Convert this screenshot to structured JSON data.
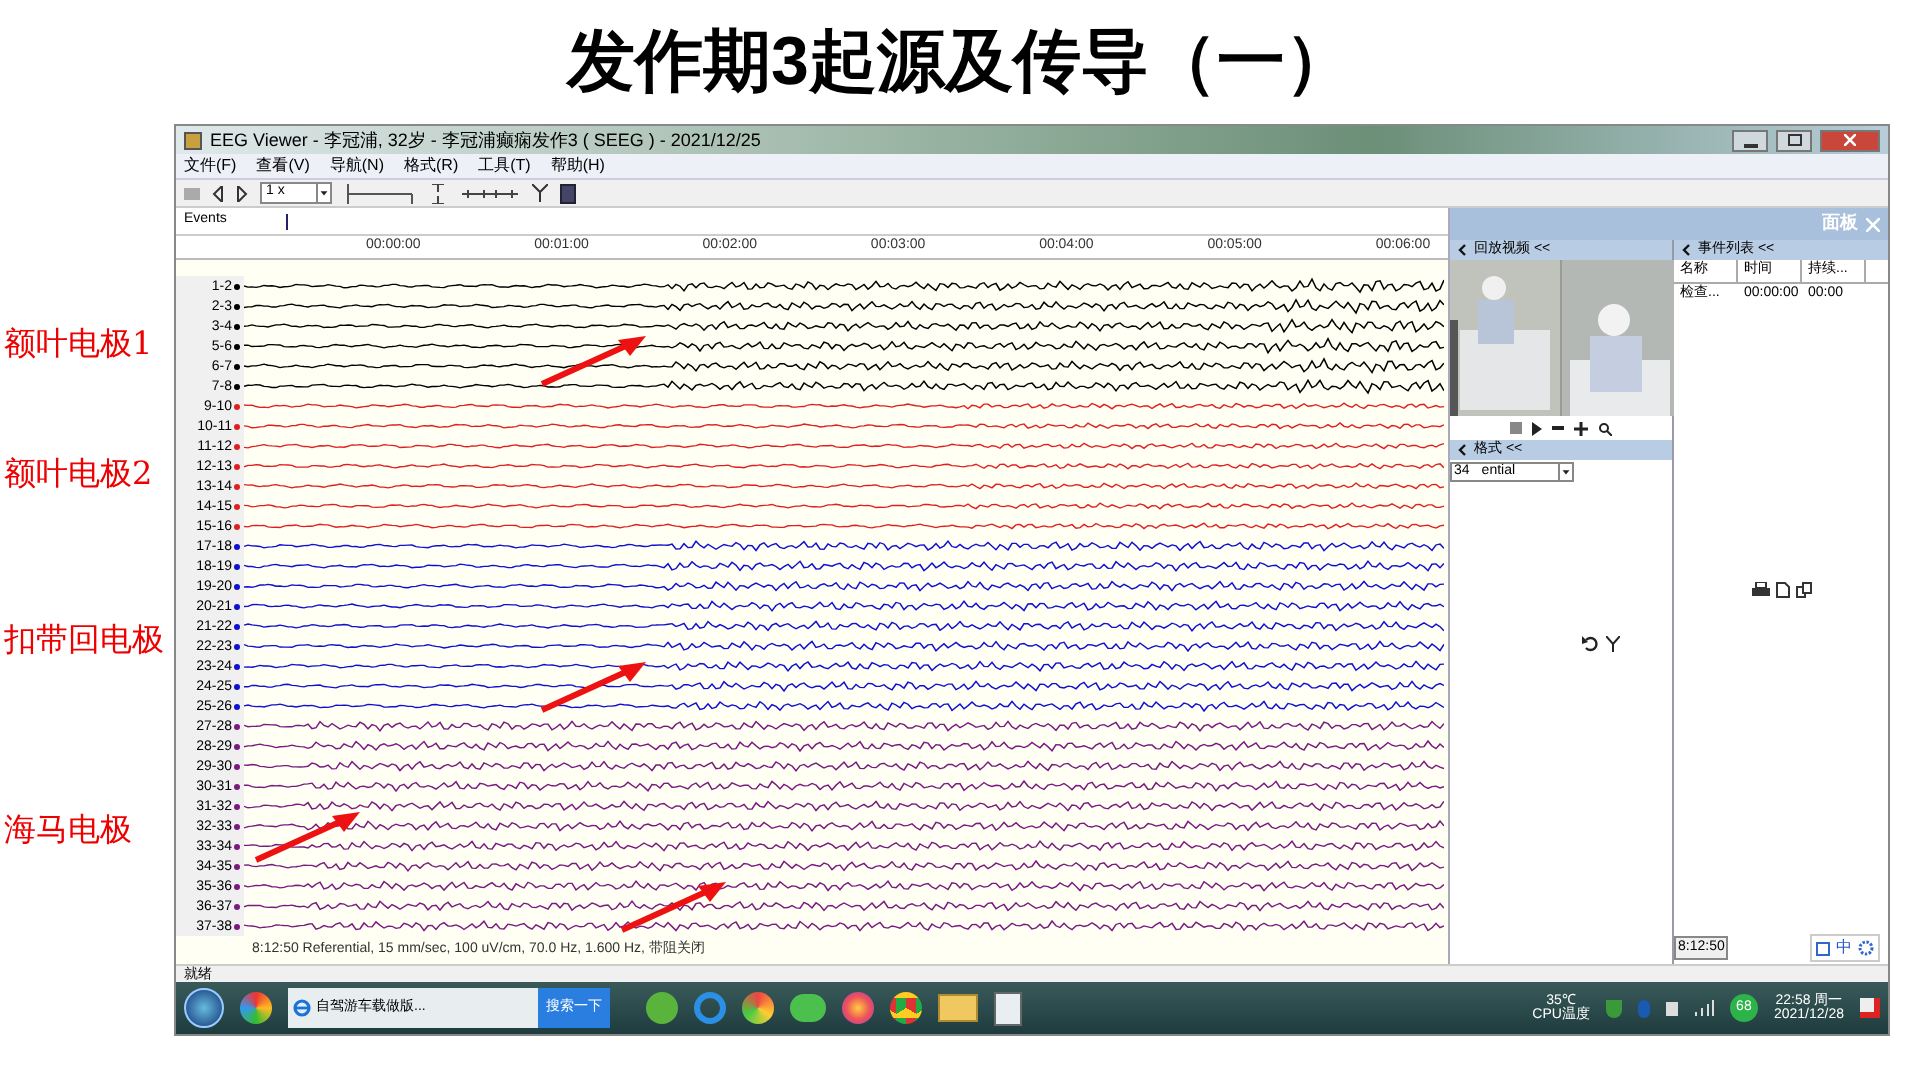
{
  "slide_title": "发作期3起源及传导（一）",
  "group_labels": [
    {
      "text": "额叶电极1"
    },
    {
      "text": "额叶电极2"
    },
    {
      "text": "扣带回电极"
    },
    {
      "text": "海马电极"
    }
  ],
  "window": {
    "title": "EEG Viewer - 李冠浦, 32岁 - 李冠浦癫痫发作3 ( SEEG ) - 2021/12/25"
  },
  "menu": [
    "文件(F)",
    "查看(V)",
    "导航(N)",
    "格式(R)",
    "工具(T)",
    "帮助(H)"
  ],
  "toolbar": {
    "speed": "1 x"
  },
  "events_label": "Events",
  "time_ruler": [
    "00:00:00",
    "00:01:00",
    "00:02:00",
    "00:03:00",
    "00:04:00",
    "00:05:00",
    "00:06:00"
  ],
  "channels": [
    {
      "label": "1-2",
      "color": "#000000"
    },
    {
      "label": "2-3",
      "color": "#000000"
    },
    {
      "label": "3-4",
      "color": "#000000"
    },
    {
      "label": "5-6",
      "color": "#000000"
    },
    {
      "label": "6-7",
      "color": "#000000"
    },
    {
      "label": "7-8",
      "color": "#000000"
    },
    {
      "label": "9-10",
      "color": "#e02020"
    },
    {
      "label": "10-11",
      "color": "#e02020"
    },
    {
      "label": "11-12",
      "color": "#e02020"
    },
    {
      "label": "12-13",
      "color": "#e02020"
    },
    {
      "label": "13-14",
      "color": "#e02020"
    },
    {
      "label": "14-15",
      "color": "#e02020"
    },
    {
      "label": "15-16",
      "color": "#e02020"
    },
    {
      "label": "17-18",
      "color": "#1010d0"
    },
    {
      "label": "18-19",
      "color": "#1010d0"
    },
    {
      "label": "19-20",
      "color": "#1010d0"
    },
    {
      "label": "20-21",
      "color": "#1010d0"
    },
    {
      "label": "21-22",
      "color": "#1010d0"
    },
    {
      "label": "22-23",
      "color": "#1010d0"
    },
    {
      "label": "23-24",
      "color": "#1010d0"
    },
    {
      "label": "24-25",
      "color": "#1010d0"
    },
    {
      "label": "25-26",
      "color": "#1010d0"
    },
    {
      "label": "27-28",
      "color": "#7a1a80"
    },
    {
      "label": "28-29",
      "color": "#7a1a80"
    },
    {
      "label": "29-30",
      "color": "#7a1a80"
    },
    {
      "label": "30-31",
      "color": "#7a1a80"
    },
    {
      "label": "31-32",
      "color": "#7a1a80"
    },
    {
      "label": "32-33",
      "color": "#7a1a80"
    },
    {
      "label": "33-34",
      "color": "#7a1a80"
    },
    {
      "label": "34-35",
      "color": "#7a1a80"
    },
    {
      "label": "35-36",
      "color": "#7a1a80"
    },
    {
      "label": "36-37",
      "color": "#7a1a80"
    },
    {
      "label": "37-38",
      "color": "#7a1a80"
    }
  ],
  "eeg_status": "8:12:50 Referential, 15 mm/sec, 100 uV/cm, 70.0 Hz, 1.600 Hz, 带阻关闭",
  "panel": {
    "title": "面板",
    "video": {
      "title": "回放视频 <<"
    },
    "format": {
      "title": "格式 <<",
      "value_1": "34",
      "value_2": "ential"
    },
    "events": {
      "title": "事件列表 <<",
      "columns": [
        "名称",
        "时间",
        "持续..."
      ],
      "rows": [
        [
          "检查...",
          "00:00:00",
          "00:00"
        ]
      ]
    },
    "time": "8:12:50"
  },
  "status_bar": "就绪",
  "taskbar": {
    "task": "自驾游车载做版...",
    "search_button": "搜索一下",
    "temperature": "35℃",
    "temperature_label": "CPU温度",
    "badge": "68",
    "clock": "22:58 周一",
    "date": "2021/12/28",
    "ime": "中"
  }
}
